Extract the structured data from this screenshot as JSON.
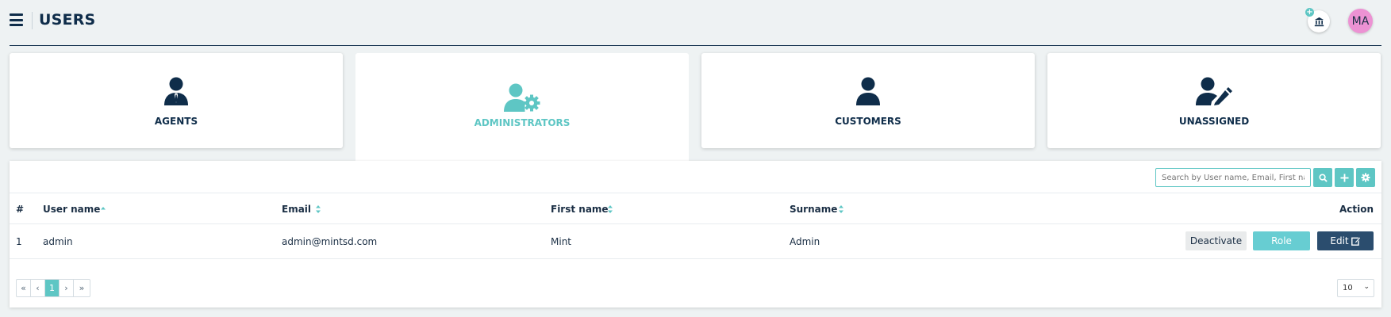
{
  "header": {
    "title": "USERS",
    "avatar_initials": "MA",
    "bank_add_symbol": "+"
  },
  "categories": [
    {
      "label": "AGENTS",
      "icon": "user-tie-icon",
      "active": false
    },
    {
      "label": "ADMINISTRATORS",
      "icon": "user-gear-icon",
      "active": true
    },
    {
      "label": "CUSTOMERS",
      "icon": "user-icon",
      "active": false
    },
    {
      "label": "UNASSIGNED",
      "icon": "user-pen-icon",
      "active": false
    }
  ],
  "search": {
    "placeholder": "Search by User name, Email, First name"
  },
  "table": {
    "headers": {
      "index": "#",
      "username": "User name",
      "email": "Email",
      "firstname": "First name",
      "surname": "Surname",
      "action": "Action"
    },
    "rows": [
      {
        "index": "1",
        "username": "admin",
        "email": "admin@mintsd.com",
        "firstname": "Mint",
        "surname": "Admin"
      }
    ],
    "actions": {
      "deactivate": "Deactivate",
      "role": "Role",
      "edit": "Edit"
    }
  },
  "pagination": {
    "first": "«",
    "prev": "‹",
    "current": "1",
    "next": "›",
    "last": "»",
    "page_size": "10"
  },
  "colors": {
    "accent": "#5ec6c4",
    "navy": "#0f2d4a",
    "avatar": "#ec92d3",
    "edit_button": "#2b4d6e"
  }
}
